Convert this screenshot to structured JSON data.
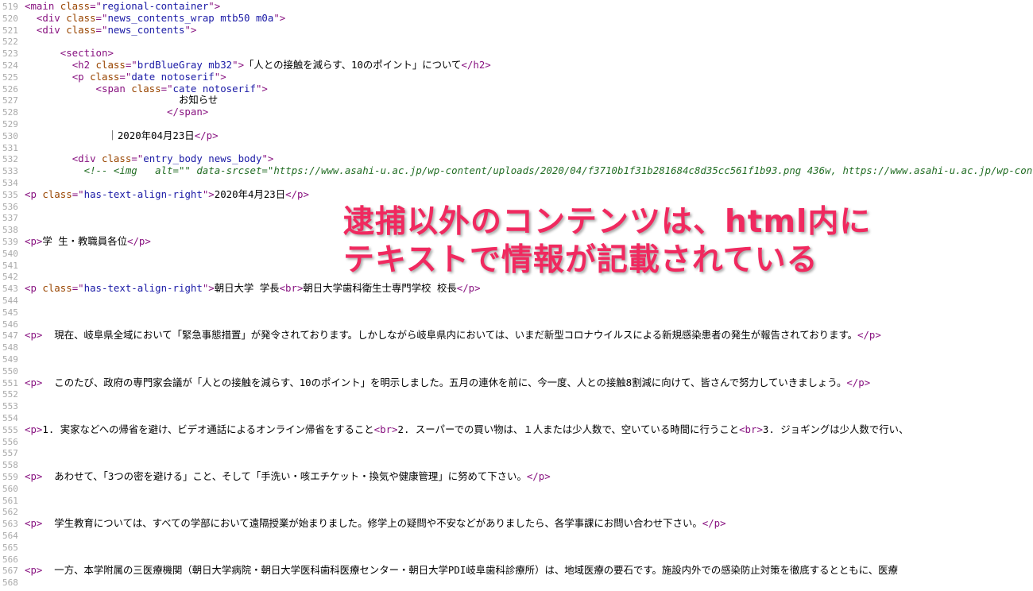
{
  "source_lines": [
    {
      "n": "519",
      "parts": [
        [
          "t",
          "<main "
        ],
        [
          "a",
          "class"
        ],
        [
          "t",
          "=\""
        ],
        [
          "v",
          "regional-container"
        ],
        [
          "t",
          "\">"
        ]
      ]
    },
    {
      "n": "520",
      "parts": [
        [
          "x",
          "  "
        ],
        [
          "t",
          "<div "
        ],
        [
          "a",
          "class"
        ],
        [
          "t",
          "=\""
        ],
        [
          "v",
          "news_contents_wrap mtb50 m0a"
        ],
        [
          "t",
          "\">"
        ]
      ]
    },
    {
      "n": "521",
      "parts": [
        [
          "x",
          "  "
        ],
        [
          "t",
          "<div "
        ],
        [
          "a",
          "class"
        ],
        [
          "t",
          "=\""
        ],
        [
          "v",
          "news_contents"
        ],
        [
          "t",
          "\">"
        ]
      ]
    },
    {
      "n": "522",
      "parts": []
    },
    {
      "n": "523",
      "parts": [
        [
          "x",
          "      "
        ],
        [
          "t",
          "<section>"
        ]
      ]
    },
    {
      "n": "524",
      "parts": [
        [
          "x",
          "        "
        ],
        [
          "t",
          "<h2 "
        ],
        [
          "a",
          "class"
        ],
        [
          "t",
          "=\""
        ],
        [
          "v",
          "brdBlueGray mb32"
        ],
        [
          "t",
          "\">"
        ],
        [
          "x",
          "「人との接触を減らす、10のポイント」について"
        ],
        [
          "t",
          "</h2>"
        ]
      ]
    },
    {
      "n": "525",
      "parts": [
        [
          "x",
          "        "
        ],
        [
          "t",
          "<p "
        ],
        [
          "a",
          "class"
        ],
        [
          "t",
          "=\""
        ],
        [
          "v",
          "date notoserif"
        ],
        [
          "t",
          "\">"
        ]
      ]
    },
    {
      "n": "526",
      "parts": [
        [
          "x",
          "            "
        ],
        [
          "t",
          "<span "
        ],
        [
          "a",
          "class"
        ],
        [
          "t",
          "=\""
        ],
        [
          "v",
          "cate notoserif"
        ],
        [
          "t",
          "\">"
        ]
      ]
    },
    {
      "n": "527",
      "parts": [
        [
          "x",
          "                          お知らせ"
        ]
      ]
    },
    {
      "n": "528",
      "parts": [
        [
          "x",
          "                        "
        ],
        [
          "t",
          "</span>"
        ]
      ]
    },
    {
      "n": "529",
      "parts": []
    },
    {
      "n": "530",
      "parts": [
        [
          "x",
          "              ｜2020年04月23日"
        ],
        [
          "t",
          "</p>"
        ]
      ]
    },
    {
      "n": "531",
      "parts": []
    },
    {
      "n": "532",
      "parts": [
        [
          "x",
          "        "
        ],
        [
          "t",
          "<div "
        ],
        [
          "a",
          "class"
        ],
        [
          "t",
          "=\""
        ],
        [
          "v",
          "entry_body news_body"
        ],
        [
          "t",
          "\">"
        ]
      ]
    },
    {
      "n": "533",
      "parts": [
        [
          "x",
          "          "
        ],
        [
          "c",
          "<!-- <img   alt=\"\" data-srcset=\"https://www.asahi-u.ac.jp/wp-content/uploads/2020/04/f3710b1f31b281684c8d35cc561f1b93.png 436w, https://www.asahi-u.ac.jp/wp-content/"
        ]
      ]
    },
    {
      "n": "534",
      "parts": []
    },
    {
      "n": "535",
      "parts": [
        [
          "t",
          "<p "
        ],
        [
          "a",
          "class"
        ],
        [
          "t",
          "=\""
        ],
        [
          "v",
          "has-text-align-right"
        ],
        [
          "t",
          "\">"
        ],
        [
          "x",
          "2020年4月23日"
        ],
        [
          "t",
          "</p>"
        ]
      ]
    },
    {
      "n": "536",
      "parts": []
    },
    {
      "n": "537",
      "parts": []
    },
    {
      "n": "538",
      "parts": []
    },
    {
      "n": "539",
      "parts": [
        [
          "t",
          "<p>"
        ],
        [
          "x",
          "学 生・教職員各位"
        ],
        [
          "t",
          "</p>"
        ]
      ]
    },
    {
      "n": "540",
      "parts": []
    },
    {
      "n": "541",
      "parts": []
    },
    {
      "n": "542",
      "parts": []
    },
    {
      "n": "543",
      "parts": [
        [
          "t",
          "<p "
        ],
        [
          "a",
          "class"
        ],
        [
          "t",
          "=\""
        ],
        [
          "v",
          "has-text-align-right"
        ],
        [
          "t",
          "\">"
        ],
        [
          "x",
          "朝日大学 学長"
        ],
        [
          "t",
          "<br>"
        ],
        [
          "x",
          "朝日大学歯科衛生士専門学校 校長"
        ],
        [
          "t",
          "</p>"
        ]
      ]
    },
    {
      "n": "544",
      "parts": []
    },
    {
      "n": "545",
      "parts": []
    },
    {
      "n": "546",
      "parts": []
    },
    {
      "n": "547",
      "parts": [
        [
          "t",
          "<p>"
        ],
        [
          "x",
          "  現在、岐阜県全域において「緊急事態措置」が発令されております。しかしながら岐阜県内においては、いまだ新型コロナウイルスによる新規感染患者の発生が報告されております。"
        ],
        [
          "t",
          "</p>"
        ]
      ]
    },
    {
      "n": "548",
      "parts": []
    },
    {
      "n": "549",
      "parts": []
    },
    {
      "n": "550",
      "parts": []
    },
    {
      "n": "551",
      "parts": [
        [
          "t",
          "<p>"
        ],
        [
          "x",
          "  このたび、政府の専門家会議が「人との接触を減らす、10のポイント」を明示しました。五月の連休を前に、今一度、人との接触8割減に向けて、皆さんで努力していきましょう。"
        ],
        [
          "t",
          "</p>"
        ]
      ]
    },
    {
      "n": "552",
      "parts": []
    },
    {
      "n": "553",
      "parts": []
    },
    {
      "n": "554",
      "parts": []
    },
    {
      "n": "555",
      "parts": [
        [
          "t",
          "<p>"
        ],
        [
          "x",
          "1. 実家などへの帰省を避け、ビデオ通話によるオンライン帰省をすること"
        ],
        [
          "t",
          "<br>"
        ],
        [
          "x",
          "2. スーパーでの買い物は、１人または少人数で、空いている時間に行うこと"
        ],
        [
          "t",
          "<br>"
        ],
        [
          "x",
          "3. ジョギングは少人数で行い、"
        ]
      ]
    },
    {
      "n": "556",
      "parts": []
    },
    {
      "n": "557",
      "parts": []
    },
    {
      "n": "558",
      "parts": []
    },
    {
      "n": "559",
      "parts": [
        [
          "t",
          "<p>"
        ],
        [
          "x",
          "  あわせて、「3つの密を避ける」こと、そして「手洗い・咳エチケット・換気や健康管理」に努めて下さい。"
        ],
        [
          "t",
          "</p>"
        ]
      ]
    },
    {
      "n": "560",
      "parts": []
    },
    {
      "n": "561",
      "parts": []
    },
    {
      "n": "562",
      "parts": []
    },
    {
      "n": "563",
      "parts": [
        [
          "t",
          "<p>"
        ],
        [
          "x",
          "  学生教育については、すべての学部において遠隔授業が始まりました。修学上の疑問や不安などがありましたら、各学事課にお問い合わせ下さい。"
        ],
        [
          "t",
          "</p>"
        ]
      ]
    },
    {
      "n": "564",
      "parts": []
    },
    {
      "n": "565",
      "parts": []
    },
    {
      "n": "566",
      "parts": []
    },
    {
      "n": "567",
      "parts": [
        [
          "t",
          "<p>"
        ],
        [
          "x",
          "  一方、本学附属の三医療機関（朝日大学病院・朝日大学医科歯科医療センター・朝日大学PDI岐阜歯科診療所）は、地域医療の要石です。施設内外での感染防止対策を徹底するとともに、医療"
        ]
      ]
    },
    {
      "n": "568",
      "parts": []
    }
  ],
  "overlay": {
    "line1": "逮捕以外のコンテンツは、html内に",
    "line2": "テキストで情報が記載されている"
  },
  "colors": {
    "tag": "#881280",
    "attribute": "#994500",
    "value": "#1a1aa6",
    "comment": "#236e25",
    "overlay_text": "#f0295f"
  }
}
